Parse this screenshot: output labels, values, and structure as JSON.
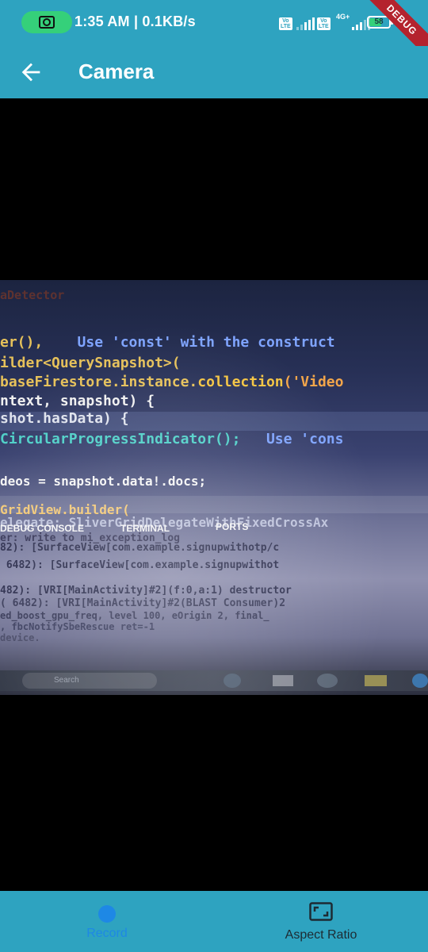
{
  "status_bar": {
    "time_speed": "1:35 AM | 0.1KB/s",
    "lte_label": "Vo\nLTE",
    "network_type": "4G+",
    "battery_level": "58",
    "debug_banner": "DEBUG"
  },
  "app_bar": {
    "title": "Camera"
  },
  "preview_code": {
    "l1": "aDetector",
    "l2a": "er(),",
    "l2b": "    Use 'const' with the construct",
    "l3": "ilder<QuerySnapshot>(",
    "l4a": "baseFirestore.instance.",
    "l4b": "collection",
    "l4c": "('Video",
    "l5": "ntext, snapshot) {",
    "l6": "shot.hasData) {",
    "l7a": "CircularProgressIndicator();",
    "l7b": "   Use 'cons",
    "l8": "deos = snapshot.data!.docs;",
    "l9": "GridView.builder(",
    "l10": "elegate: SliverGridDelegateWithFixedCrossAx",
    "tab1": "DEBUG CONSOLE",
    "tab2": "TERMINAL",
    "tab3": "PORTS",
    "c1": "er: write to mi_exception_log",
    "c2": "82): [SurfaceView[com.example.signupwithotp/c",
    "c3": " 6482): [SurfaceView[com.example.signupwithot",
    "c4": "482): [VRI[MainActivity]#2](f:0,a:1) destructor",
    "c5": "( 6482): [VRI[MainActivity]#2(BLAST Consumer)2",
    "c6": "ed_boost_gpu_freq, level 100, eOrigin 2, final_",
    "c7": ", fbcNotifySbeRescue ret=-1",
    "c8": "device.",
    "taskbar_search": "Search"
  },
  "bottom_nav": {
    "record_label": "Record",
    "aspect_label": "Aspect Ratio"
  },
  "colors": {
    "bar": "#2ea3c0",
    "accent": "#1e88e5",
    "debug": "#b4232e",
    "battery": "#35d07a"
  }
}
